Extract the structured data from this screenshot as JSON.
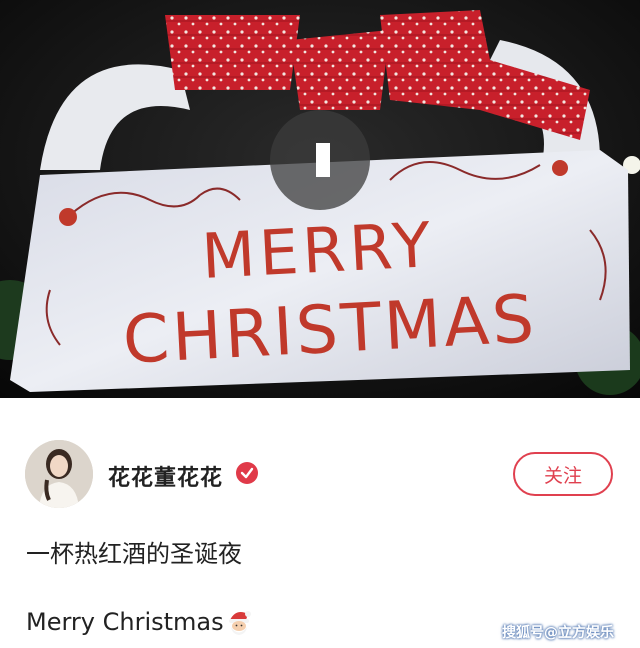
{
  "media": {
    "sign_line1": "MERRY",
    "sign_line2": "CHRISTMAS"
  },
  "author": {
    "name": "花花董花花",
    "follow_label": "关注"
  },
  "post": {
    "text_line1": "一杯热红酒的圣诞夜",
    "text_line2": "Merry Christmas"
  },
  "watermark": "搜狐号@立方娱乐",
  "colors": {
    "accent_red": "#e0404f",
    "sign_text": "#c0392b"
  }
}
